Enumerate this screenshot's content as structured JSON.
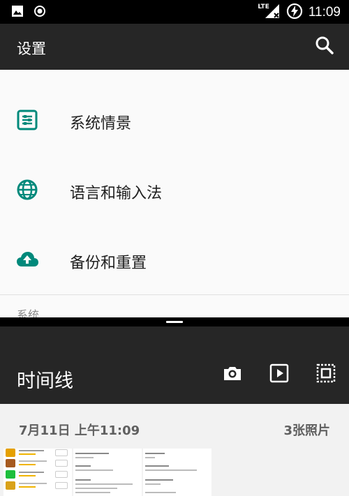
{
  "status_bar": {
    "network": "LTE",
    "time": "11:09",
    "icons": [
      "image-icon",
      "circle-record-icon",
      "signal-icon",
      "battery-charging-icon"
    ]
  },
  "settings": {
    "title": "设置",
    "items": [
      {
        "label": "系统情景",
        "icon": "dashboard-icon"
      },
      {
        "label": "语言和输入法",
        "icon": "globe-icon"
      },
      {
        "label": "备份和重置",
        "icon": "cloud-upload-icon"
      }
    ],
    "section_header": "系统",
    "accent_color": "#00897b"
  },
  "gallery": {
    "title": "时间线",
    "date": "7月11日 上午11:09",
    "count": "3张照片",
    "actions": [
      "camera-icon",
      "slideshow-icon",
      "select-all-icon"
    ]
  }
}
